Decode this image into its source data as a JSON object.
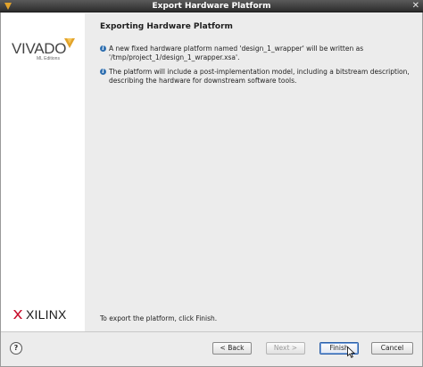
{
  "window": {
    "title": "Export Hardware Platform",
    "close_glyph": "✕"
  },
  "sidebar": {
    "vivado_word": "VIVADO",
    "edition": "ML Editions",
    "vendor_word": "XILINX"
  },
  "main": {
    "title": "Exporting Hardware Platform",
    "info": [
      {
        "text": "A new fixed hardware platform named 'design_1_wrapper' will be written as '/tmp/project_1/design_1_wrapper.xsa'."
      },
      {
        "text": "The platform will include a post-implementation model, including a bitstream description, describing the hardware for downstream software tools."
      }
    ],
    "footer_note": "To export the platform, click Finish."
  },
  "buttons": {
    "help": "?",
    "back": "< Back",
    "next": "Next >",
    "finish": "Finish",
    "cancel": "Cancel"
  },
  "colors": {
    "accent": "#2b5fa8",
    "info_icon": "#2f6fb0",
    "vivado_mark": "#e2a32b",
    "xilinx_mark": "#c8102e"
  }
}
